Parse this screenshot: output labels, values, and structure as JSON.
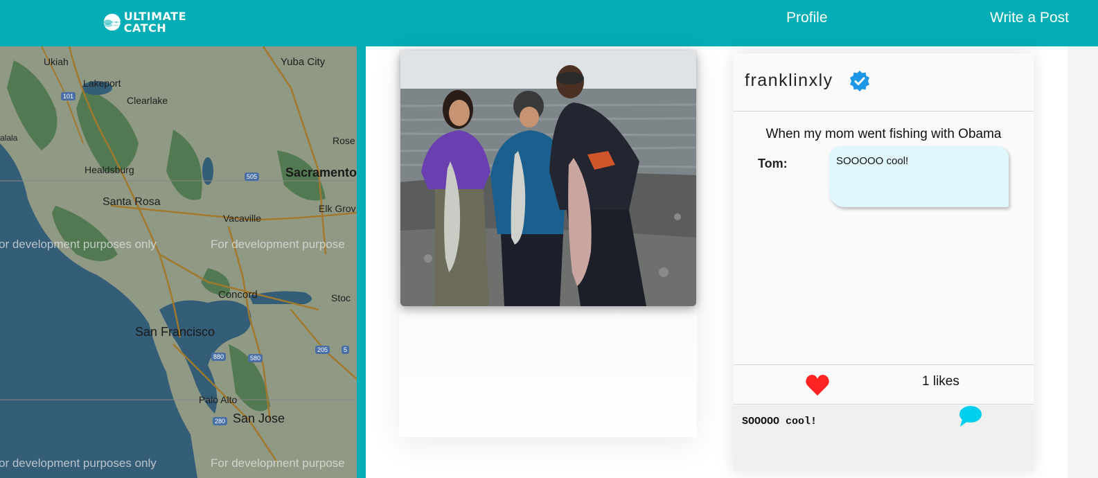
{
  "nav": {
    "logo_line1": "ULTIMATE",
    "logo_line2": "CATCH",
    "profile_label": "Profile",
    "write_post_label": "Write a Post"
  },
  "map": {
    "cities": [
      "Ukiah",
      "Yuba City",
      "Lakeport",
      "Clearlake",
      "Healdsburg",
      "Sacramento",
      "Santa Rosa",
      "Vacaville",
      "Elk Grov",
      "Concord",
      "San Francisco",
      "Palo Alto",
      "San Jose",
      "Rose",
      "Stoc",
      "alala"
    ],
    "roads": [
      "101",
      "505",
      "880",
      "580",
      "205",
      "5",
      "280"
    ],
    "watermark": "For development purposes only",
    "watermark_left": "or development purposes only",
    "watermark_right": "For development purpose"
  },
  "post": {
    "username": "franklinxly",
    "caption": "When my mom went fishing with Obama",
    "comments": [
      {
        "author": "Tom:",
        "text": "SOOOOO cool!"
      }
    ],
    "likes_text": "1 likes",
    "comment_input_value": "SOOOOO cool!"
  },
  "colors": {
    "brand": "#03adb5",
    "heart": "#ff2222",
    "verified": "#1e96e6",
    "comment_icon": "#00d0ee",
    "bubble": "#e0f7fd"
  },
  "icons": {
    "verified": "verified-badge-icon",
    "like": "heart-icon",
    "comment": "speech-bubble-icon"
  }
}
